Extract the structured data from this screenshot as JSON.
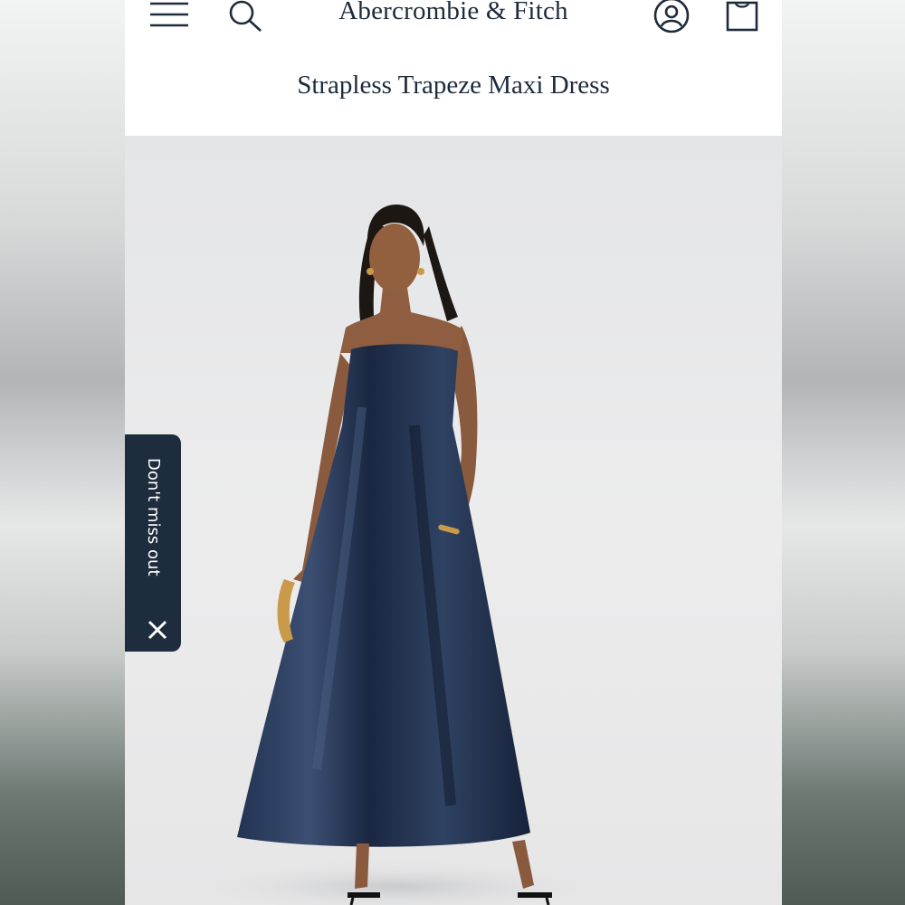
{
  "header": {
    "brand": "Abercrombie & Fitch",
    "menu_icon": "hamburger-menu-icon",
    "search_icon": "search-icon",
    "account_icon": "user-account-icon",
    "bag_icon": "shopping-bag-icon"
  },
  "product": {
    "title": "Strapless Trapeze Maxi Dress",
    "image_subject": "Model wearing navy satin strapless trapeze maxi dress"
  },
  "promo_tab": {
    "label": "Don't miss out",
    "close_icon": "close-icon"
  },
  "colors": {
    "brand_navy": "#1d2b3a",
    "promo_bg": "#1d2d3e",
    "dress": "#1b2a44"
  }
}
